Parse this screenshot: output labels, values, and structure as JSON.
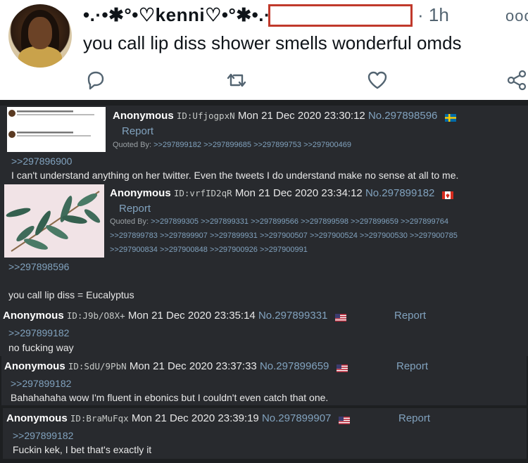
{
  "tweet": {
    "user_name": "•.·•✱°•♡kenni♡•°✱•.·•",
    "time": "· 1h",
    "text": "you call lip diss shower smells wonderful omds"
  },
  "posts": [
    {
      "name": "Anonymous",
      "id_label": "ID:UfjogpxN",
      "date": "Mon 21 Dec 2020 23:30:12",
      "no": "No.297898596",
      "flag": "sweden-flag",
      "report": "Report",
      "quoted_by_label": "Quoted By:",
      "quoted_by": [
        ">>297899182",
        ">>297899685",
        ">>297899753",
        ">>297900469"
      ],
      "reply_to": ">>297896900",
      "text": "I can't understand anything on her twitter. Even the tweets I do understand make no sense at all to me."
    },
    {
      "name": "Anonymous",
      "id_label": "ID:vrfID2qR",
      "date": "Mon 21 Dec 2020 23:34:12",
      "no": "No.297899182",
      "flag": "canada-flag",
      "report": "Report",
      "quoted_by_label": "Quoted By:",
      "quoted_by": [
        ">>297899305",
        ">>297899331",
        ">>297899566",
        ">>297899598",
        ">>297899659",
        ">>297899764",
        ">>297899783",
        ">>297899907",
        ">>297899931",
        ">>297900507",
        ">>297900524",
        ">>297900530",
        ">>297900785",
        ">>297900834",
        ">>297900848",
        ">>297900926",
        ">>297900991"
      ],
      "reply_to": ">>297898596",
      "text": "you call lip diss = Eucalyptus"
    },
    {
      "name": "Anonymous",
      "id_label": "ID:J9b/O8X+",
      "date": "Mon 21 Dec 2020 23:35:14",
      "no": "No.297899331",
      "flag": "usa-flag",
      "report": "Report",
      "reply_to": ">>297899182",
      "text": "no fucking way"
    },
    {
      "name": "Anonymous",
      "id_label": "ID:SdU/9PbN",
      "date": "Mon 21 Dec 2020 23:37:33",
      "no": "No.297899659",
      "flag": "usa-flag",
      "report": "Report",
      "reply_to": ">>297899182",
      "text": "Bahahahaha wow I'm fluent in ebonics but I couldn't even catch that one."
    },
    {
      "name": "Anonymous",
      "id_label": "ID:BraMuFqx",
      "date": "Mon 21 Dec 2020 23:39:19",
      "no": "No.297899907",
      "flag": "usa-flag",
      "report": "Report",
      "reply_to": ">>297899182",
      "text": "Fuckin kek, I bet that's exactly it"
    }
  ],
  "colors": {
    "thread_bg": "#1d1f21",
    "post_bg": "#282a2e",
    "link": "#81a2be",
    "redact_border": "#c0392b"
  }
}
